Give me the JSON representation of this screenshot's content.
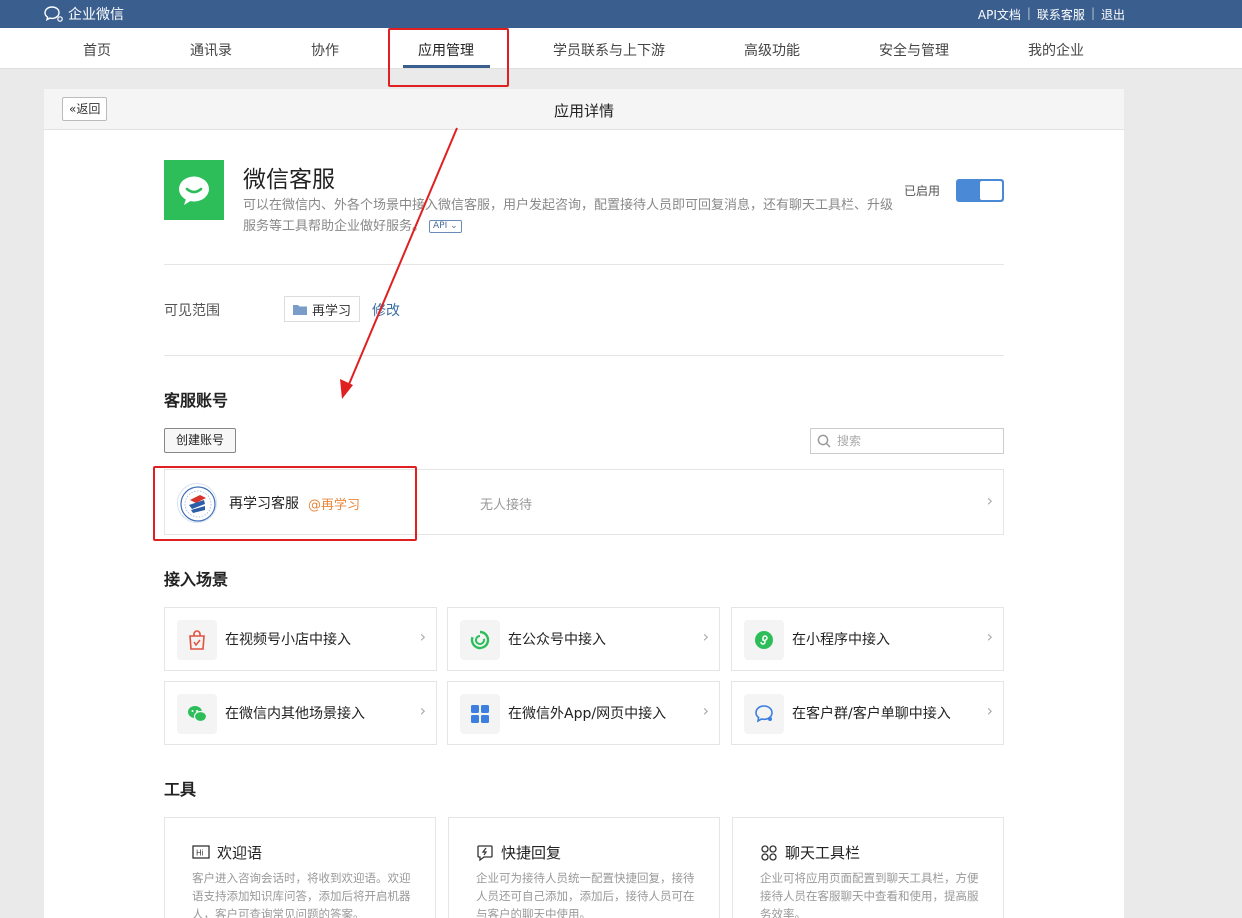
{
  "topbar": {
    "logo_text": "企业微信",
    "links": [
      "API文档",
      "联系客服",
      "退出"
    ]
  },
  "nav": {
    "items": [
      "首页",
      "通讯录",
      "协作",
      "应用管理",
      "学员联系与上下游",
      "高级功能",
      "安全与管理",
      "我的企业"
    ],
    "active": "应用管理"
  },
  "header": {
    "back_label": "返回",
    "title": "应用详情"
  },
  "app": {
    "name": "微信客服",
    "description": "可以在微信内、外各个场景中接入微信客服，用户发起咨询，配置接待人员即可回复消息，还有聊天工具栏、升级服务等工具帮助企业做好服务。",
    "api_badge": "API",
    "status_label": "已启用",
    "enabled": true
  },
  "scope": {
    "label": "可见范围",
    "value": "再学习",
    "edit_label": "修改"
  },
  "accounts": {
    "title": "客服账号",
    "create_label": "创建账号",
    "search_placeholder": "搜索",
    "items": [
      {
        "name": "再学习客服",
        "tag": "@再学习",
        "status": "无人接待"
      }
    ]
  },
  "scenes": {
    "title": "接入场景",
    "items": [
      {
        "label": "在视频号小店中接入",
        "icon": "shop-bag-icon"
      },
      {
        "label": "在公众号中接入",
        "icon": "official-account-icon"
      },
      {
        "label": "在小程序中接入",
        "icon": "mini-program-icon"
      },
      {
        "label": "在微信内其他场景接入",
        "icon": "wechat-icon"
      },
      {
        "label": "在微信外App/网页中接入",
        "icon": "app-grid-icon"
      },
      {
        "label": "在客户群/客户单聊中接入",
        "icon": "chat-bubble-icon"
      }
    ]
  },
  "tools": {
    "title": "工具",
    "items": [
      {
        "title": "欢迎语",
        "icon": "hi-icon",
        "desc": "客户进入咨询会话时，将收到欢迎语。欢迎语支持添加知识库问答，添加后将开启机器人，客户可查询常见问题的答案。"
      },
      {
        "title": "快捷回复",
        "icon": "quick-reply-icon",
        "desc": "企业可为接待人员统一配置快捷回复，接待人员还可自己添加，添加后，接待人员可在与客户的聊天中使用。"
      },
      {
        "title": "聊天工具栏",
        "icon": "toolbar-grid-icon",
        "desc": "企业可将应用页面配置到聊天工具栏，方便接待人员在客服聊天中查看和使用，提高服务效率。"
      }
    ]
  },
  "colors": {
    "topbar": "#3a5f8f",
    "app_green": "#2dbe5a",
    "toggle_blue": "#4a89d6",
    "tag_orange": "#e8863b",
    "annotation_red": "#e02020"
  }
}
